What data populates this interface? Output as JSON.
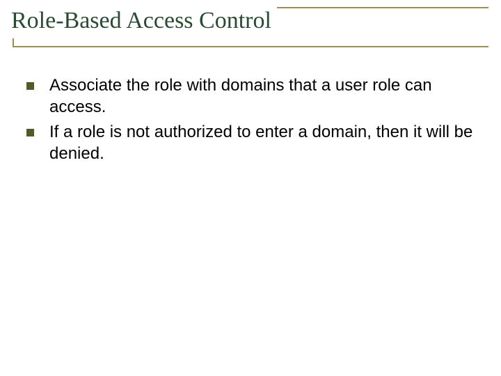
{
  "colors": {
    "title_text": "#2a4a32",
    "rule": "#9a8f55",
    "bullet": "#4f5b2b",
    "body_text": "#000000"
  },
  "title": "Role-Based Access Control",
  "bullets": [
    {
      "text": "Associate the role with domains that a user role can access."
    },
    {
      "text": "If a role is not authorized to enter a domain, then it will be denied."
    }
  ]
}
